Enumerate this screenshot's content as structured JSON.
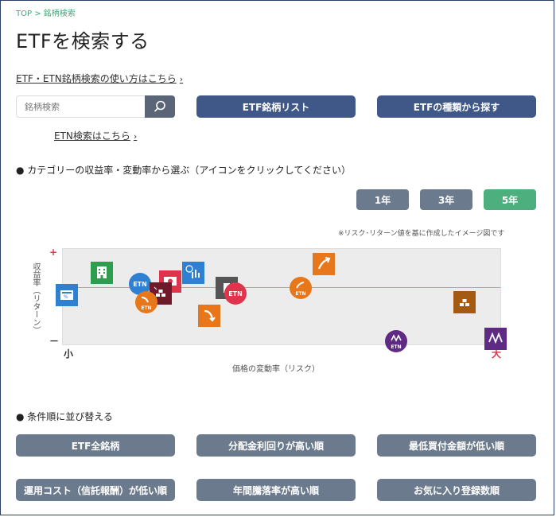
{
  "breadcrumb": {
    "home": "TOP",
    "sep": ">",
    "current": "銘柄検索"
  },
  "page_title": "ETFを検索する",
  "howto_link": "ETF・ETN銘柄検索の使い方はこちら",
  "search": {
    "placeholder": "銘柄検索"
  },
  "buttons": {
    "list": "ETF銘柄リスト",
    "types": "ETFの種類から探す"
  },
  "etn_link": "ETN検索はこちら",
  "category_heading": "● カテゴリーの収益率・変動率から選ぶ（アイコンをクリックしてください）",
  "period_tabs": [
    {
      "label": "1年",
      "selected": false
    },
    {
      "label": "3年",
      "selected": false
    },
    {
      "label": "5年",
      "selected": true
    }
  ],
  "chart_note": "※リスク･リターン値を基に作成したイメージ図です",
  "chart_axes": {
    "y_label": "収益率（リターン）",
    "y_plus": "+",
    "y_minus": "－",
    "x_label": "価格の変動率（リスク）",
    "x_small": "小",
    "x_large": "大"
  },
  "sort_heading": "● 条件順に並び替える",
  "sort_buttons": [
    "ETF全銘柄",
    "分配金利回りが高い順",
    "最低買付金額が低い順",
    "運用コスト（信託報酬）が低い順",
    "年間騰落率が高い順",
    "お気に入り登録数順"
  ],
  "colors": {
    "primary": "#3f5887",
    "secondary": "#6b7a8d",
    "selected": "#4caf7d",
    "accent_green": "#3aaa77"
  }
}
